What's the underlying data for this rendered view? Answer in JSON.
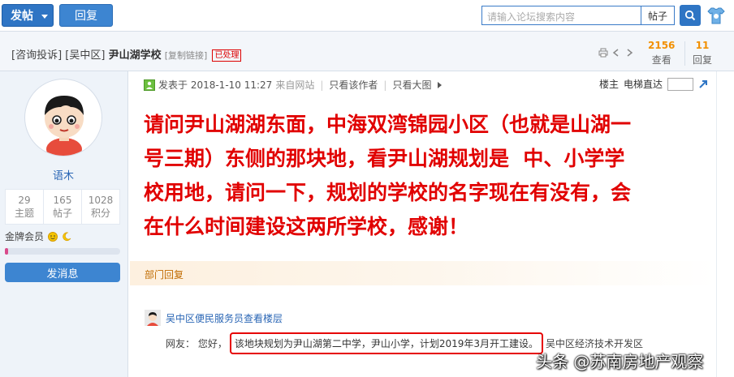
{
  "toolbar": {
    "post_label": "发帖",
    "reply_label": "回复",
    "search_placeholder": "请输入论坛搜索内容",
    "search_type": "帖子"
  },
  "thread": {
    "title_parts": [
      "[咨询投诉]",
      "[吴中区]",
      "尹山湖学校"
    ],
    "copy_link": "[复制链接]",
    "status_badge": "已处理",
    "views": "2156",
    "views_label": "查看",
    "replies": "11",
    "replies_label": "回复"
  },
  "author": {
    "name": "语木",
    "stats": [
      {
        "value": "29",
        "label": "主题"
      },
      {
        "value": "165",
        "label": "帖子"
      },
      {
        "value": "1028",
        "label": "积分"
      }
    ],
    "rank": "金牌会员",
    "level_progress": 0.03,
    "message_button": "发消息"
  },
  "post": {
    "posted_on": "发表于 2018-1-10 11:27",
    "source": "来自网站",
    "only_author": "只看该作者",
    "large_image": "只看大图",
    "floor_label": "楼主",
    "jump_label": "电梯直达",
    "lines": [
      "请问尹山湖湖东面，中海双湾锦园小区（也就是山湖一",
      "号三期）东侧的那块地，看尹山湖规划是  中、小学学",
      "校用地，请问一下，规划的学校的名字现在有没有，会",
      "在什么时间建设这两所学校，感谢！"
    ]
  },
  "official_reply": {
    "section_label": "部门回复",
    "responder": "吴中区便民服务员查看楼层",
    "prefix": "网友：  您好，",
    "highlight": "该地块规划为尹山湖第二中学，尹山小学，计划2019年3月开工建设。",
    "suffix": "吴中区经济技术开发区"
  },
  "watermark": "头条 @苏南房地产观察",
  "colors": {
    "accent_blue": "#2f75c4",
    "post_text": "#e10000",
    "stat_orange": "#f29000",
    "highlight_border": "#e60000"
  }
}
